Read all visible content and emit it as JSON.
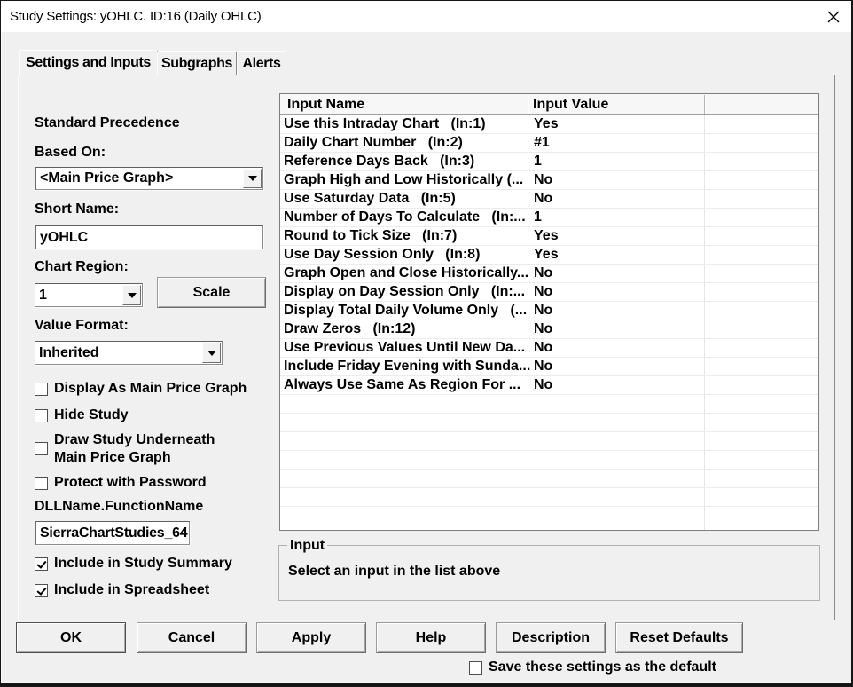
{
  "window": {
    "title": "Study Settings: yOHLC. ID:16 (Daily OHLC)"
  },
  "tabs": [
    {
      "label": "Settings and Inputs",
      "active": true
    },
    {
      "label": "Subgraphs",
      "active": false
    },
    {
      "label": "Alerts",
      "active": false
    }
  ],
  "left_panel": {
    "section_label": "Standard Precedence",
    "based_on": {
      "label": "Based On:",
      "value": "<Main Price Graph>"
    },
    "short_name": {
      "label": "Short Name:",
      "value": "yOHLC"
    },
    "chart_region": {
      "label": "Chart Region:",
      "value": "1"
    },
    "scale_button_label": "Scale",
    "value_format": {
      "label": "Value Format:",
      "value": "Inherited"
    },
    "checkboxes": [
      {
        "label": "Display As Main Price Graph",
        "checked": false
      },
      {
        "label": "Hide Study",
        "checked": false
      },
      {
        "label": "Draw Study Underneath Main Price Graph",
        "checked": false
      },
      {
        "label": "Protect with Password",
        "checked": false
      }
    ],
    "dll_label": "DLLName.FunctionName",
    "dll_value": "SierraChartStudies_64",
    "include_checkboxes": [
      {
        "label": "Include in Study Summary",
        "checked": true
      },
      {
        "label": "Include in Spreadsheet",
        "checked": true
      }
    ]
  },
  "inputs_table": {
    "columns": [
      "Input Name",
      "Input Value",
      ""
    ],
    "rows": [
      {
        "name": "Use this Intraday Chart   (In:1)",
        "value": "Yes"
      },
      {
        "name": "Daily Chart Number   (In:2)",
        "value": "#1"
      },
      {
        "name": "Reference Days Back   (In:3)",
        "value": "1"
      },
      {
        "name": "Graph High and Low Historically (...",
        "value": "No"
      },
      {
        "name": "Use Saturday Data   (In:5)",
        "value": "No"
      },
      {
        "name": "Number of Days To Calculate   (In:...",
        "value": "1"
      },
      {
        "name": "Round to Tick Size   (In:7)",
        "value": "Yes"
      },
      {
        "name": "Use Day Session Only   (In:8)",
        "value": "Yes"
      },
      {
        "name": "Graph Open and Close Historically...",
        "value": "No"
      },
      {
        "name": "Display on Day Session Only   (In:...",
        "value": "No"
      },
      {
        "name": "Display Total Daily Volume Only   (...",
        "value": "No"
      },
      {
        "name": "Draw Zeros   (In:12)",
        "value": "No"
      },
      {
        "name": "Use Previous Values Until New Da...",
        "value": "No"
      },
      {
        "name": "Include Friday Evening with Sunda...",
        "value": "No"
      },
      {
        "name": "Always Use Same As Region For ...",
        "value": "No"
      }
    ],
    "empty_row_count": 8
  },
  "input_group": {
    "label": "Input",
    "message": "Select an input in the list above"
  },
  "footer": {
    "buttons": [
      "OK",
      "Cancel",
      "Apply",
      "Help",
      "Description",
      "Reset Defaults"
    ],
    "save_checkbox": {
      "label": "Save these settings as the default",
      "checked": false
    }
  },
  "colors": {
    "dialog_background": "#f0f0f0",
    "titlebar_background": "#ffffff",
    "text": "#000000",
    "table_background": "#ffffff",
    "table_border": "#7d7d7d",
    "row_separator": "#ececec",
    "screen_edge": "#161616"
  }
}
